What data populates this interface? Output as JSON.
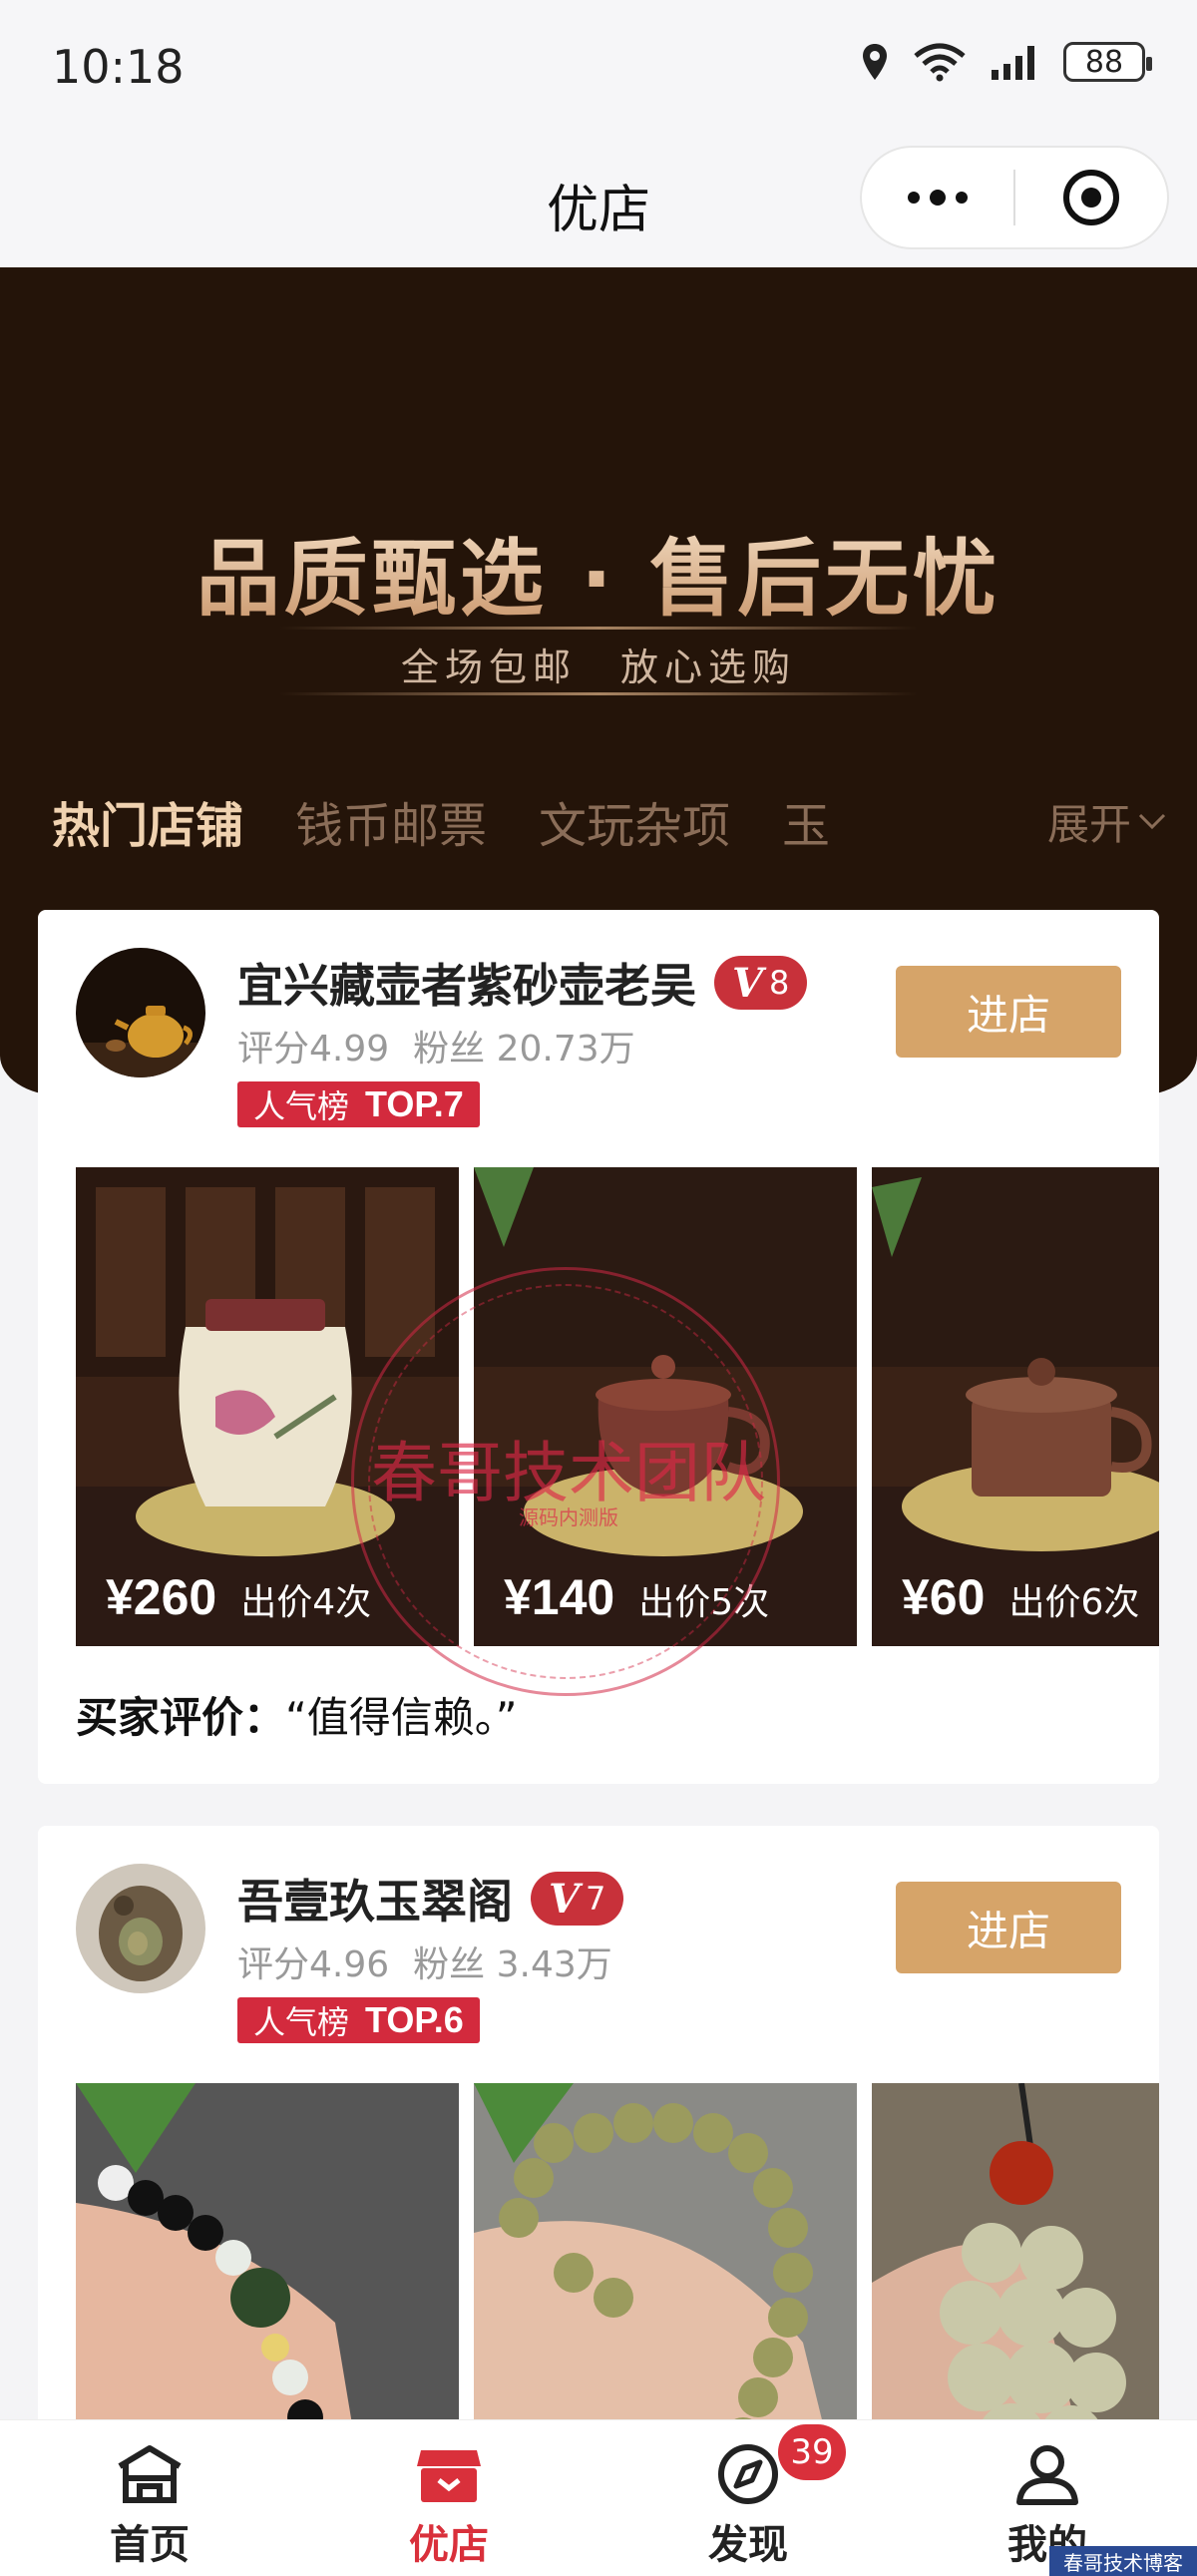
{
  "status_bar": {
    "time": "10:18",
    "battery": "88"
  },
  "title_bar": {
    "title": "优店"
  },
  "banner": {
    "slogan": "品质甄选 · 售后无忧",
    "subslogan": "全场包邮　放心选购"
  },
  "tabs": [
    {
      "label": "热门店铺",
      "active": true
    },
    {
      "label": "钱币邮票",
      "active": false
    },
    {
      "label": "文玩杂项",
      "active": false
    },
    {
      "label": "玉",
      "active": false
    }
  ],
  "expand_label": "展开",
  "shops": [
    {
      "name": "宜兴藏壶者紫砂壶老吴",
      "level": "8",
      "rating": "评分4.99",
      "fans": "粉丝 20.73万",
      "rank_label": "人气榜",
      "rank_value": "TOP.7",
      "enter_label": "进店",
      "items": [
        {
          "price": "¥260",
          "bids": "出价4次"
        },
        {
          "price": "¥140",
          "bids": "出价5次"
        },
        {
          "price": "¥60",
          "bids": "出价6次"
        }
      ],
      "review_label": "买家评价：",
      "review_text": "“值得信赖。”"
    },
    {
      "name": "吾壹玖玉翠阁",
      "level": "7",
      "rating": "评分4.96",
      "fans": "粉丝 3.43万",
      "rank_label": "人气榜",
      "rank_value": "TOP.6",
      "enter_label": "进店"
    }
  ],
  "watermark": {
    "text": "春哥技术团队",
    "small": "源码内测版",
    "corner": "春哥技术博客"
  },
  "bottom_nav": [
    {
      "label": "首页",
      "icon": "home-icon",
      "active": false
    },
    {
      "label": "优店",
      "icon": "shop-icon",
      "active": true
    },
    {
      "label": "发现",
      "icon": "compass-icon",
      "active": false,
      "badge": "39"
    },
    {
      "label": "我的",
      "icon": "user-icon",
      "active": false
    }
  ],
  "colors": {
    "accent": "#d9303b",
    "enter_button": "#d6a469",
    "banner_bg": "#241409",
    "badge_red": "#c8313a"
  }
}
